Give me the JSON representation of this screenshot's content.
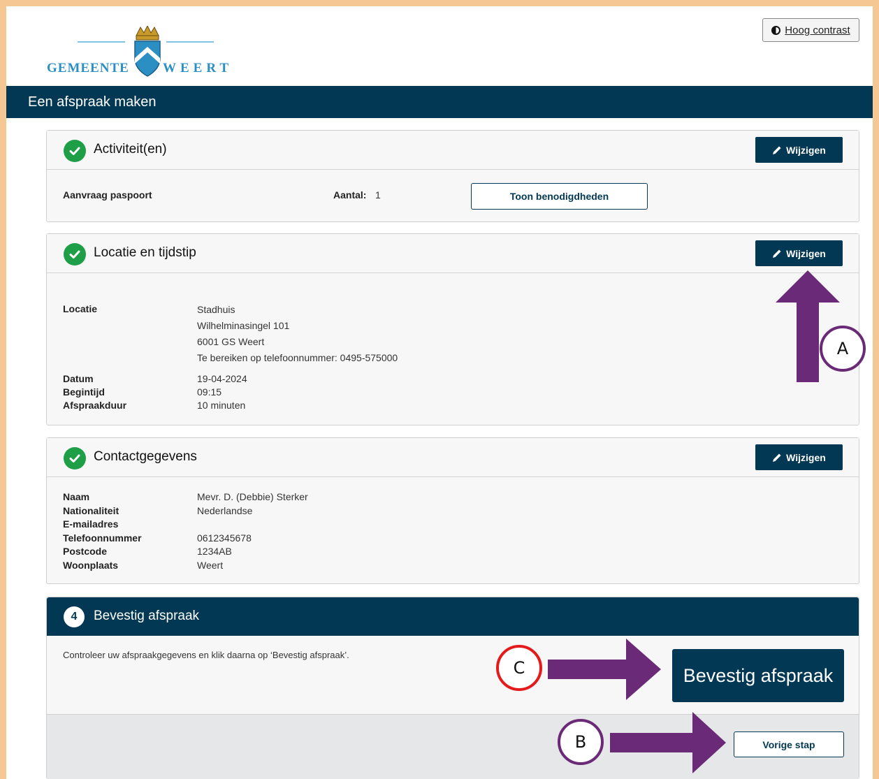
{
  "header": {
    "logo_left": "GEMEENTE",
    "logo_right": "WEERT",
    "contrast_label": "Hoog contrast"
  },
  "page_title": "Een afspraak maken",
  "sections": {
    "activiteiten": {
      "title": "Activiteit(en)",
      "edit_label": "Wijzigen",
      "item": "Aanvraag paspoort",
      "aantal_label": "Aantal:",
      "aantal_value": "1",
      "toon_label": "Toon benodigdheden"
    },
    "locatie": {
      "title": "Locatie en tijdstip",
      "edit_label": "Wijzigen",
      "locatie_label": "Locatie",
      "address": [
        "Stadhuis",
        "Wilhelminasingel 101",
        "6001 GS Weert",
        "Te bereiken op telefoonnummer: 0495-575000"
      ],
      "datum_label": "Datum",
      "datum_value": "19-04-2024",
      "begintijd_label": "Begintijd",
      "begintijd_value": "09:15",
      "duur_label": "Afspraakduur",
      "duur_value": "10 minuten"
    },
    "contact": {
      "title": "Contactgegevens",
      "edit_label": "Wijzigen",
      "rows": [
        {
          "label": "Naam",
          "value": "Mevr. D. (Debbie) Sterker"
        },
        {
          "label": "Nationaliteit",
          "value": "Nederlandse"
        },
        {
          "label": "E-mailadres",
          "value": ""
        },
        {
          "label": "Telefoonnummer",
          "value": "0612345678"
        },
        {
          "label": "Postcode",
          "value": "1234AB"
        },
        {
          "label": "Woonplaats",
          "value": "Weert"
        }
      ]
    },
    "bevestig": {
      "step": "4",
      "title": "Bevestig afspraak",
      "instruction": "Controleer uw afspraakgegevens en klik daarna op ‘Bevestig afspraak’.",
      "confirm_label": "Bevestig afspraak",
      "back_label": "Vorige stap"
    }
  },
  "annotations": {
    "a": "A",
    "b": "B",
    "c": "C",
    "arrow_color": "#6b2a77",
    "circle_red": "#e31b1b"
  }
}
